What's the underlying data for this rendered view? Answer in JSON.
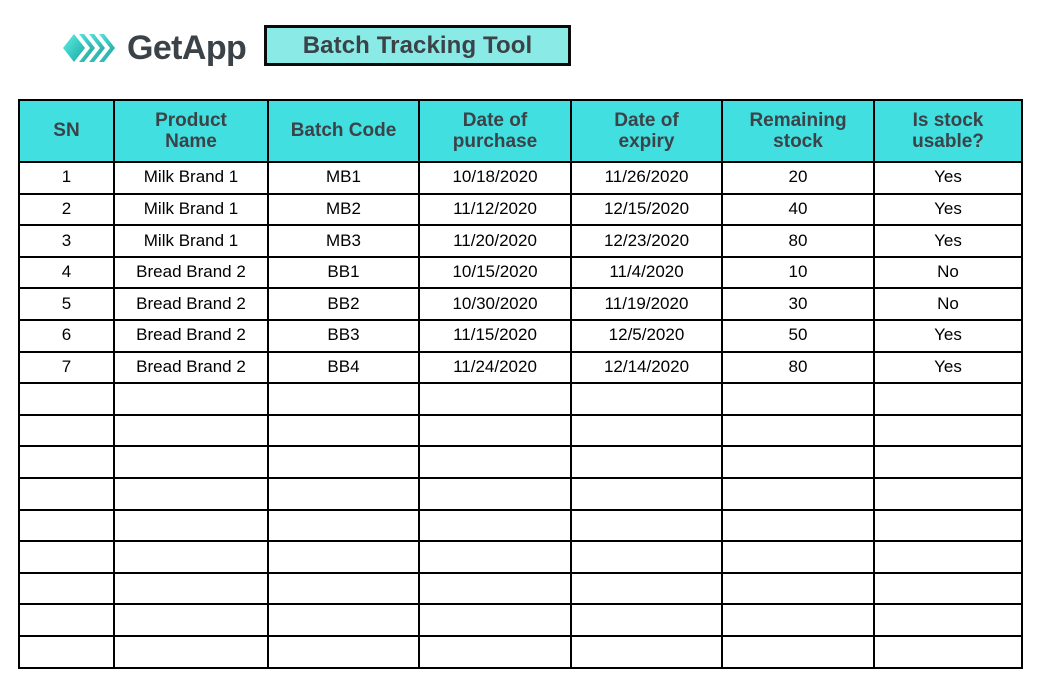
{
  "brand": {
    "logo_icon": "getapp-chevron-logo",
    "wordmark": "GetApp"
  },
  "title": {
    "text": "Batch Tracking Tool"
  },
  "colors": {
    "header_fill": "#41dfdf",
    "title_fill": "#8aeae5",
    "border": "#000000",
    "header_text": "#3b4248",
    "body_text": "#000000"
  },
  "table": {
    "columns": [
      "SN",
      "Product Name",
      "Batch Code",
      "Date of purchase",
      "Date of expiry",
      "Remaining stock",
      "Is stock usable?"
    ],
    "column_lines": [
      [
        "SN"
      ],
      [
        "Product",
        "Name"
      ],
      [
        "Batch Code"
      ],
      [
        "Date of",
        "purchase"
      ],
      [
        "Date of",
        "expiry"
      ],
      [
        "Remaining",
        "stock"
      ],
      [
        "Is stock",
        "usable?"
      ]
    ],
    "rows": [
      [
        "1",
        "Milk Brand 1",
        "MB1",
        "10/18/2020",
        "11/26/2020",
        "20",
        "Yes"
      ],
      [
        "2",
        "Milk Brand 1",
        "MB2",
        "11/12/2020",
        "12/15/2020",
        "40",
        "Yes"
      ],
      [
        "3",
        "Milk Brand 1",
        "MB3",
        "11/20/2020",
        "12/23/2020",
        "80",
        "Yes"
      ],
      [
        "4",
        "Bread Brand 2",
        "BB1",
        "10/15/2020",
        "11/4/2020",
        "10",
        "No"
      ],
      [
        "5",
        "Bread Brand 2",
        "BB2",
        "10/30/2020",
        "11/19/2020",
        "30",
        "No"
      ],
      [
        "6",
        "Bread Brand 2",
        "BB3",
        "11/15/2020",
        "12/5/2020",
        "50",
        "Yes"
      ],
      [
        "7",
        "Bread Brand 2",
        "BB4",
        "11/24/2020",
        "12/14/2020",
        "80",
        "Yes"
      ]
    ],
    "blank_row_count": 9
  }
}
